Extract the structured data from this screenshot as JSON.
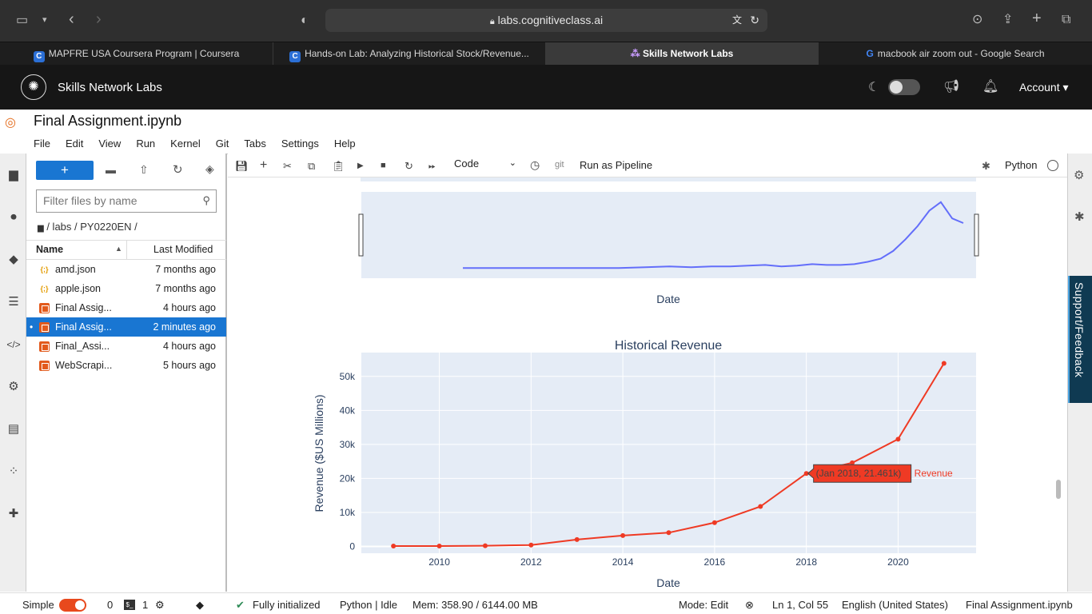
{
  "browser": {
    "url": "labs.cognitiveclass.ai",
    "tabs": [
      {
        "label": "MAPFRE USA Coursera Program | Coursera"
      },
      {
        "label": "Hands-on Lab: Analyzing Historical Stock/Revenue..."
      },
      {
        "label": "Skills Network Labs"
      },
      {
        "label": "macbook air zoom out - Google Search"
      }
    ]
  },
  "header": {
    "brand": "Skills Network Labs",
    "account": "Account"
  },
  "notebook": {
    "title": "Final Assignment.ipynb"
  },
  "menu": [
    "File",
    "Edit",
    "View",
    "Run",
    "Kernel",
    "Git",
    "Tabs",
    "Settings",
    "Help"
  ],
  "filebrowser": {
    "new_label": "+",
    "search_placeholder": "Filter files by name",
    "breadcrumb": "/ labs / PY0220EN /",
    "col_name": "Name",
    "col_modified": "Last Modified",
    "files": [
      {
        "name": "amd.json",
        "modified": "7 months ago",
        "type": "json"
      },
      {
        "name": "apple.json",
        "modified": "7 months ago",
        "type": "json"
      },
      {
        "name": "Final Assig...",
        "modified": "4 hours ago",
        "type": "notebook"
      },
      {
        "name": "Final Assig...",
        "modified": "2 minutes ago",
        "type": "notebook",
        "selected": true
      },
      {
        "name": "Final_Assi...",
        "modified": "4 hours ago",
        "type": "notebook"
      },
      {
        "name": "WebScrapi...",
        "modified": "5 hours ago",
        "type": "notebook"
      }
    ]
  },
  "toolbar": {
    "cell_type": "Code",
    "git": "git",
    "pipeline": "Run as Pipeline",
    "kernel": "Python"
  },
  "support_label": "Support/Feedback",
  "status": {
    "mode_label": "Simple",
    "count0": "0",
    "count1": "1",
    "init": "Fully initialized",
    "kernel": "Python | Idle",
    "mem": "Mem: 358.90 / 6144.00 MB",
    "edit_mode": "Mode: Edit",
    "position": "Ln 1, Col 55",
    "language": "English (United States)",
    "file": "Final Assignment.ipynb"
  },
  "chart_data": [
    {
      "type": "line",
      "title": "",
      "xlabel": "Date",
      "ylabel": "",
      "series": [
        {
          "values": [
            0.08,
            0.08,
            0.08,
            0.08,
            0.09,
            0.1,
            0.09,
            0.1,
            0.1,
            0.11,
            0.12,
            0.1,
            0.11,
            0.13,
            0.12,
            0.12,
            0.13,
            0.16,
            0.2,
            0.3,
            0.45,
            0.62,
            0.82,
            0.93,
            0.72,
            0.66
          ]
        }
      ],
      "color": "#636efa"
    },
    {
      "type": "line",
      "title": "Historical Revenue",
      "xlabel": "Date",
      "ylabel": "Revenue ($US Millions)",
      "x": [
        2009,
        2010,
        2011,
        2012,
        2013,
        2014,
        2015,
        2016,
        2017,
        2018,
        2019,
        2020,
        2021
      ],
      "xticks": [
        "2010",
        "2012",
        "2014",
        "2016",
        "2018",
        "2020"
      ],
      "yticks": [
        "0",
        "10k",
        "20k",
        "30k",
        "40k",
        "50k"
      ],
      "ylim": [
        -2000,
        57000
      ],
      "series": [
        {
          "name": "Revenue",
          "values": [
            112,
            117,
            204,
            413,
            2013,
            3198,
            4046,
            7000,
            11759,
            21461,
            24578,
            31536,
            53823
          ]
        }
      ],
      "color": "#ef3a24",
      "hover": {
        "text": "(Jan 2018, 21.461k)",
        "series": "Revenue"
      }
    }
  ]
}
